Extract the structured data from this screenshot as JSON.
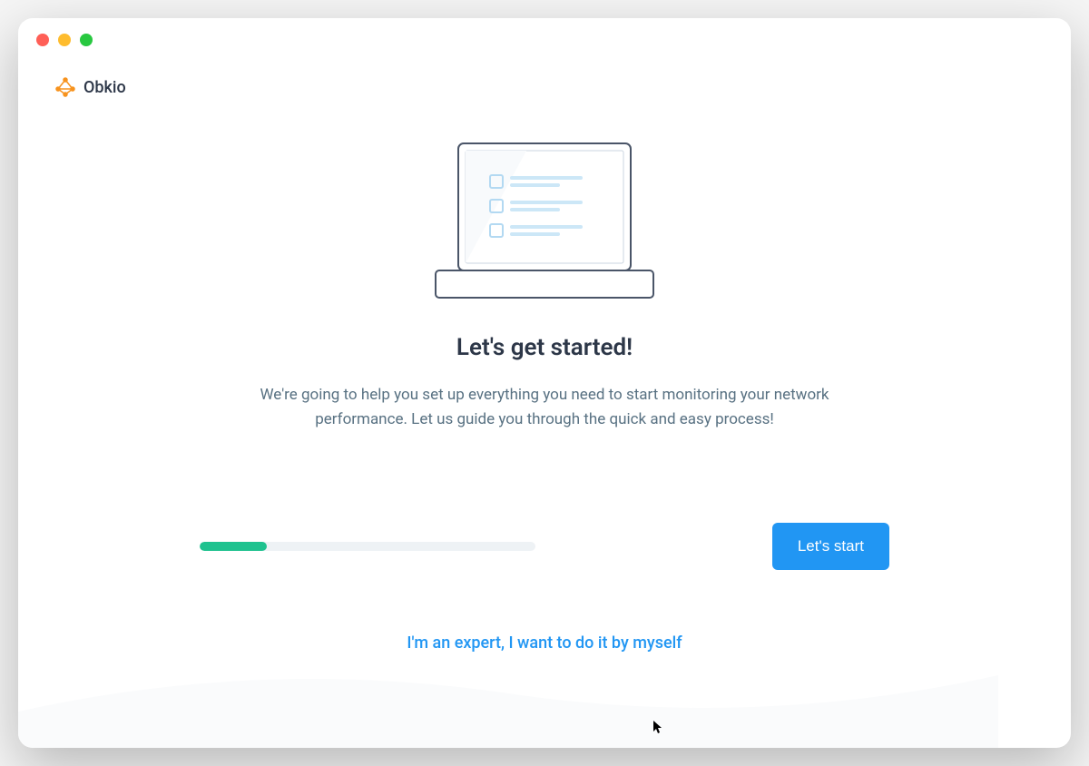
{
  "brand": {
    "name": "Obkio"
  },
  "onboarding": {
    "heading": "Let's get started!",
    "description": "We're going to help you set up everything you need to start monitoring your network performance. Let us guide you through the quick and easy process!",
    "progress_percent": 20,
    "start_button_label": "Let's start",
    "skip_link_label": "I'm an expert, I want to do it by myself"
  },
  "colors": {
    "accent_blue": "#2196f3",
    "progress_green": "#1fc28f",
    "logo_orange": "#f7931e"
  }
}
